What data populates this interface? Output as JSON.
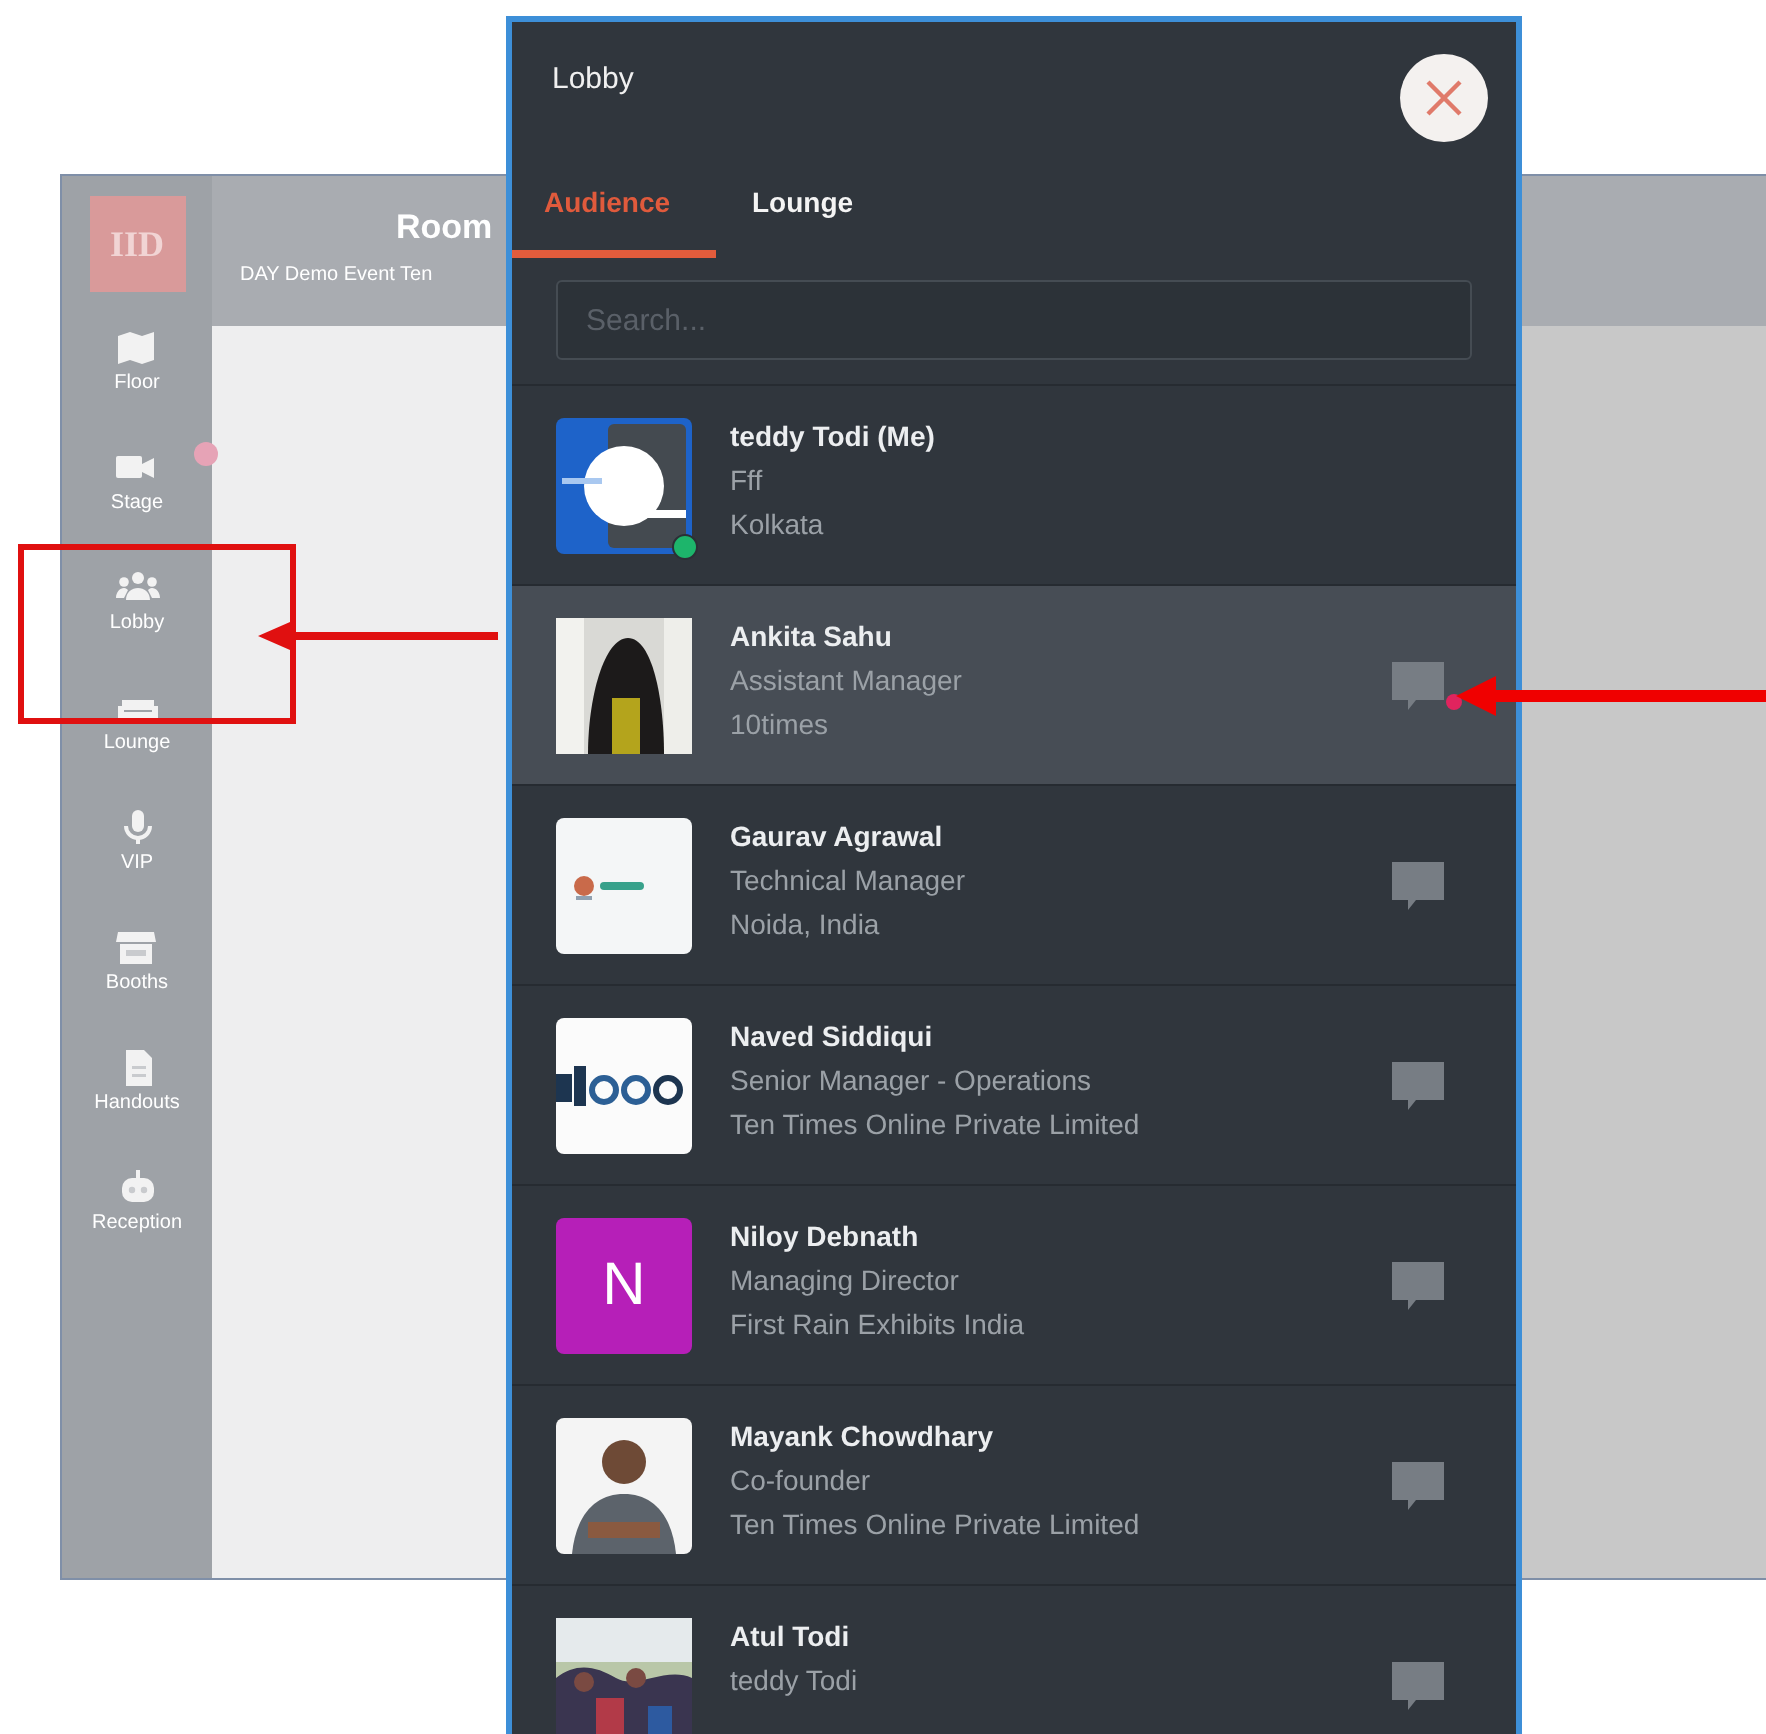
{
  "app": {
    "logo": "IID",
    "header": {
      "title": "Room",
      "subtitle": "DAY Demo Event Ten"
    },
    "sidebar": [
      {
        "label": "Floor",
        "kind": "map",
        "badge": false
      },
      {
        "label": "Stage",
        "kind": "camera",
        "badge": true
      },
      {
        "label": "Lobby",
        "kind": "people",
        "badge": false
      },
      {
        "label": "Lounge",
        "kind": "couch",
        "badge": false
      },
      {
        "label": "VIP",
        "kind": "mic",
        "badge": false
      },
      {
        "label": "Booths",
        "kind": "store",
        "badge": false
      },
      {
        "label": "Handouts",
        "kind": "document",
        "badge": false
      },
      {
        "label": "Reception",
        "kind": "robot",
        "badge": false
      }
    ]
  },
  "lobby": {
    "title": "Lobby",
    "tabs": [
      {
        "label": "Audience",
        "selected": true
      },
      {
        "label": "Lounge",
        "selected": false
      }
    ],
    "search": {
      "placeholder": "Search..."
    },
    "people": [
      {
        "name": "teddy Todi (Me)",
        "title": "Fff",
        "company": "Kolkata",
        "avatar": {
          "kind": "logo"
        },
        "online": true,
        "chat": false,
        "selected": false
      },
      {
        "name": "Ankita Sahu",
        "title": "Assistant Manager",
        "company": "10times",
        "online": false,
        "chat": true,
        "unread": true,
        "selected": true
      },
      {
        "name": "Gaurav Agrawal",
        "title": "Technical Manager",
        "company": "Noida, India",
        "avatar": {
          "kind": "logo"
        },
        "online": false,
        "chat": true,
        "unread": false,
        "selected": false
      },
      {
        "name": "Naved Siddiqui",
        "title": "Senior Manager - Operations",
        "company": "Ten Times Online Private Limited",
        "avatar": {
          "kind": "logo"
        },
        "online": false,
        "chat": true,
        "unread": false,
        "selected": false
      },
      {
        "name": "Niloy Debnath",
        "title": "Managing Director",
        "company": "First Rain Exhibits India",
        "avatar": {
          "kind": "initial",
          "letter": "N",
          "color": "#b61fb8"
        },
        "online": false,
        "chat": true,
        "unread": false,
        "selected": false
      },
      {
        "name": "Mayank Chowdhary",
        "title": "Co-founder",
        "company": "Ten Times Online Private Limited",
        "online": false,
        "chat": true,
        "unread": false,
        "selected": false
      },
      {
        "name": "Atul Todi",
        "title": "teddy Todi",
        "online": false,
        "chat": true,
        "unread": false,
        "selected": false
      }
    ]
  }
}
